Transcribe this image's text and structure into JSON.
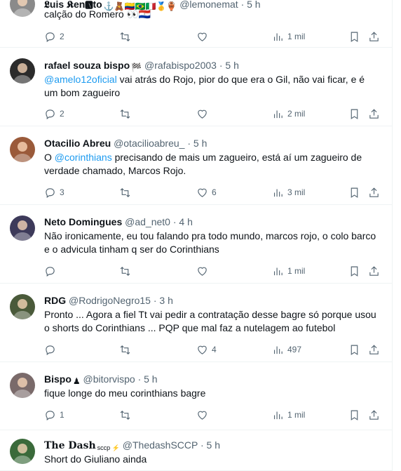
{
  "tweets": [
    {
      "name": "𝕷uis 𝕶en🅰to",
      "badges": "⚓🧸🇨🇴🇧🇷🇮🇹🥇🏺",
      "handle": "@lemonemat",
      "time": "· 5 h",
      "text": "calção do Romero 👀🇵🇾",
      "replies": "2",
      "likes": "",
      "views": "1 mil",
      "avatar_color": "#8a8a8a"
    },
    {
      "name": "rafael souza bispo",
      "badges": "🏁",
      "handle": "@rafabispo2003",
      "time": "· 5 h",
      "mention": "@amelo12oficial",
      "text": " vai atrás do Rojo, pior do que era o Gil, não vai ficar, e é um bom zagueiro",
      "replies": "2",
      "likes": "",
      "views": "2 mil",
      "avatar_color": "#2b2b2b"
    },
    {
      "name": "Otacilio Abreu",
      "badges": "",
      "handle": "@otacilioabreu_",
      "time": "· 5 h",
      "text_prefix": "O ",
      "mention": "@corinthians",
      "text": " precisando de mais um zagueiro, está aí um zagueiro de verdade chamado, Marcos Rojo.",
      "replies": "3",
      "likes": "6",
      "views": "3 mil",
      "avatar_color": "#9a5a3a"
    },
    {
      "name": "Neto Domingues",
      "badges": "",
      "handle": "@ad_net0",
      "time": "· 4 h",
      "text": "Não ironicamente, eu tou falando pra todo mundo, marcos rojo, o colo barco e o advicula tinham q ser do Corinthians",
      "replies": "",
      "likes": "",
      "views": "1 mil",
      "avatar_color": "#3d3a5a"
    },
    {
      "name": "RDG",
      "badges": "",
      "handle": "@RodrigoNegro15",
      "time": "· 3 h",
      "text": "Pronto ... Agora a fiel Tt vai pedir a contratação desse bagre só porque usou o shorts do Corinthians ... PQP que mal faz a nutelagem ao futebol",
      "replies": "",
      "likes": "4",
      "views": "497",
      "avatar_color": "#4a5a3a"
    },
    {
      "name": "Bispo",
      "badges": "♟",
      "handle": "@bitorvispo",
      "time": "· 5 h",
      "text": "fique longe do meu corinthians bagre",
      "replies": "1",
      "likes": "",
      "views": "1 mil",
      "avatar_color": "#7a6a6a"
    },
    {
      "name": "The Dash",
      "badges": "sccp ⚡",
      "handle": "@ThedashSCCP",
      "time": "· 5 h",
      "text": "Short do Giuliano ainda",
      "avatar_color": "#3a6a3a"
    }
  ],
  "colors": {
    "accent": "#1d9bf0",
    "secondary_text": "#536471",
    "border": "#eff3f4"
  },
  "icons": [
    "reply-icon",
    "retweet-icon",
    "like-icon",
    "views-icon",
    "bookmark-icon",
    "share-icon"
  ]
}
